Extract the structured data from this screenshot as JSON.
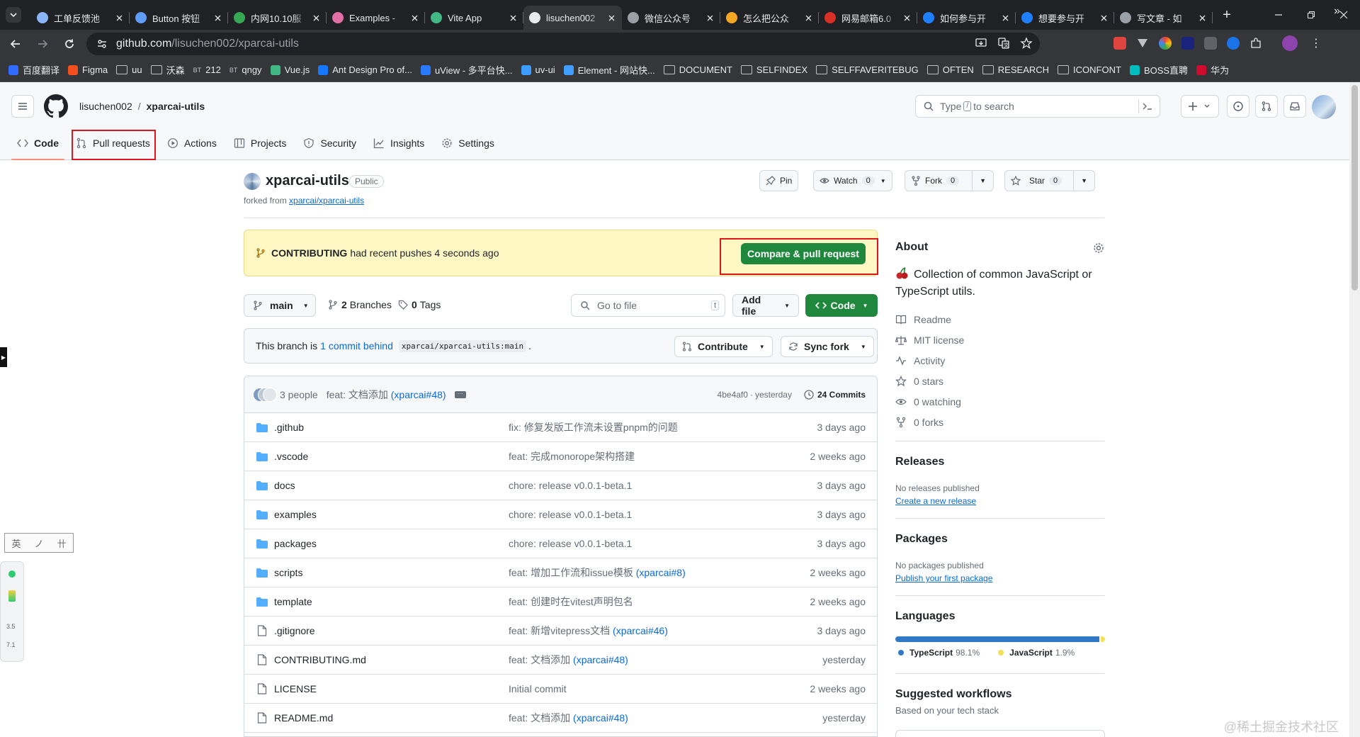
{
  "browser": {
    "tabs": [
      {
        "label": "工单反馈池",
        "color": "#8ab4f8"
      },
      {
        "label": "Button 按钮",
        "color": "#5e9cf7"
      },
      {
        "label": "内网10.10服",
        "color": "#34a853"
      },
      {
        "label": "Examples -",
        "color": "#e26fa6"
      },
      {
        "label": "Vite App",
        "color": "#41b883"
      },
      {
        "label": "lisuchen002",
        "color": "#e8eaed"
      },
      {
        "label": "微信公众号",
        "color": "#9aa0a6"
      },
      {
        "label": "怎么把公众",
        "color": "#f5a623"
      },
      {
        "label": "网易邮箱6.0",
        "color": "#d93025"
      },
      {
        "label": "如何参与开",
        "color": "#1e80ff"
      },
      {
        "label": "想要参与开",
        "color": "#1e80ff"
      },
      {
        "label": "写文章 - 如",
        "color": "#9aa0a6"
      }
    ],
    "active_tab": 5,
    "url_host": "github.com",
    "url_path": "/lisuchen002/xparcai-utils",
    "bookmarks": [
      {
        "label": "百度翻译",
        "type": "site",
        "color": "#2f6bff"
      },
      {
        "label": "Figma",
        "type": "site",
        "color": "#f24e1e"
      },
      {
        "label": "uu",
        "type": "folder"
      },
      {
        "label": "沃森",
        "type": "folder"
      },
      {
        "label": "212",
        "type": "site",
        "color": "#5f6368",
        "prefix": "BT"
      },
      {
        "label": "qngy",
        "type": "site",
        "color": "#5f6368",
        "prefix": "BT"
      },
      {
        "label": "Vue.js",
        "type": "site",
        "color": "#41b883"
      },
      {
        "label": "Ant Design Pro of...",
        "type": "site",
        "color": "#1677ff"
      },
      {
        "label": "uView - 多平台快...",
        "type": "site",
        "color": "#2979ff"
      },
      {
        "label": "uv-ui",
        "type": "site",
        "color": "#3c9cff"
      },
      {
        "label": "Element - 网站快...",
        "type": "site",
        "color": "#409eff"
      },
      {
        "label": "DOCUMENT",
        "type": "folder"
      },
      {
        "label": "SELFINDEX",
        "type": "folder"
      },
      {
        "label": "SELFFAVERITEBUG",
        "type": "folder"
      },
      {
        "label": "OFTEN",
        "type": "folder"
      },
      {
        "label": "RESEARCH",
        "type": "folder"
      },
      {
        "label": "ICONFONT",
        "type": "folder"
      },
      {
        "label": "BOSS直聘",
        "type": "site",
        "color": "#00bebd"
      },
      {
        "label": "华为",
        "type": "site",
        "color": "#cf0a2c"
      }
    ]
  },
  "github": {
    "owner": "lisuchen002",
    "separator": "/",
    "repo": "xparcai-utils",
    "search_placeholder_pre": "Type",
    "search_key": "/",
    "search_placeholder_post": "to search",
    "tabs": [
      "Code",
      "Pull requests",
      "Actions",
      "Projects",
      "Security",
      "Insights",
      "Settings"
    ],
    "visibility": "Public",
    "forked_prefix": "forked from",
    "forked_from": "xparcai/xparcai-utils",
    "pin_label": "Pin",
    "watch_label": "Watch",
    "watch_count": "0",
    "fork_label": "Fork",
    "fork_count": "0",
    "star_label": "Star",
    "star_count": "0",
    "banner_branch": "CONTRIBUTING",
    "banner_text": "had recent pushes 4 seconds ago",
    "compare_label": "Compare & pull request",
    "branch": "main",
    "branches_count": "2",
    "branches_label": "Branches",
    "tags_count": "0",
    "tags_label": "Tags",
    "go_to_file": "Go to file",
    "go_to_file_key": "t",
    "add_file": "Add file",
    "code_label": "Code",
    "status_pre": "This branch is",
    "status_link": "1 commit behind",
    "status_ref": "xparcai/xparcai-utils:main",
    "status_post": ".",
    "contribute_label": "Contribute",
    "sync_label": "Sync fork",
    "last_commit": {
      "people": "3 people",
      "message": "feat: 文档添加",
      "pr": "(xparcai#48)",
      "hash": "4be4af0",
      "sep": "·",
      "when": "yesterday",
      "commits": "24 Commits"
    },
    "files": [
      {
        "name": ".github",
        "type": "dir",
        "msg": "fix: 修复发版工作流未设置pnpm的问题",
        "pr": "",
        "date": "3 days ago"
      },
      {
        "name": ".vscode",
        "type": "dir",
        "msg": "feat: 完成monorope架构搭建",
        "pr": "",
        "date": "2 weeks ago"
      },
      {
        "name": "docs",
        "type": "dir",
        "msg": "chore: release v0.0.1-beta.1",
        "pr": "",
        "date": "3 days ago"
      },
      {
        "name": "examples",
        "type": "dir",
        "msg": "chore: release v0.0.1-beta.1",
        "pr": "",
        "date": "3 days ago"
      },
      {
        "name": "packages",
        "type": "dir",
        "msg": "chore: release v0.0.1-beta.1",
        "pr": "",
        "date": "3 days ago"
      },
      {
        "name": "scripts",
        "type": "dir",
        "msg": "feat: 增加工作流和issue模板",
        "pr": "(xparcai#8)",
        "date": "2 weeks ago"
      },
      {
        "name": "template",
        "type": "dir",
        "msg": "feat: 创建时在vitest声明包名",
        "pr": "",
        "date": "2 weeks ago"
      },
      {
        "name": ".gitignore",
        "type": "file",
        "msg": "feat: 新增vitepress文档",
        "pr": "(xparcai#46)",
        "date": "3 days ago"
      },
      {
        "name": "CONTRIBUTING.md",
        "type": "file",
        "msg": "feat: 文档添加",
        "pr": "(xparcai#48)",
        "date": "yesterday"
      },
      {
        "name": "LICENSE",
        "type": "file",
        "msg": "Initial commit",
        "pr": "",
        "date": "2 weeks ago"
      },
      {
        "name": "README.md",
        "type": "file",
        "msg": "feat: 文档添加",
        "pr": "(xparcai#48)",
        "date": "yesterday"
      }
    ],
    "about": {
      "title": "About",
      "description": "Collection of common JavaScript or TypeScript utils.",
      "readme": "Readme",
      "license": "MIT license",
      "activity": "Activity",
      "stars": "0 stars",
      "watching": "0 watching",
      "forks": "0 forks"
    },
    "releases": {
      "title": "Releases",
      "empty": "No releases published",
      "link": "Create a new release"
    },
    "packages": {
      "title": "Packages",
      "empty": "No packages published",
      "link": "Publish your first package"
    },
    "languages": {
      "title": "Languages",
      "items": [
        {
          "name": "TypeScript",
          "pct": "98.1%",
          "value": 98.1,
          "color": "#3178c6"
        },
        {
          "name": "JavaScript",
          "pct": "1.9%",
          "value": 1.9,
          "color": "#f1e05a"
        }
      ]
    },
    "workflows": {
      "title": "Suggested workflows",
      "subtitle": "Based on your tech stack"
    }
  },
  "overlay": {
    "ime_keys": [
      "英",
      "ノ",
      "卄"
    ],
    "monitor": [
      "3.5",
      "7.1"
    ],
    "watermark": "@稀土掘金技术社区"
  }
}
